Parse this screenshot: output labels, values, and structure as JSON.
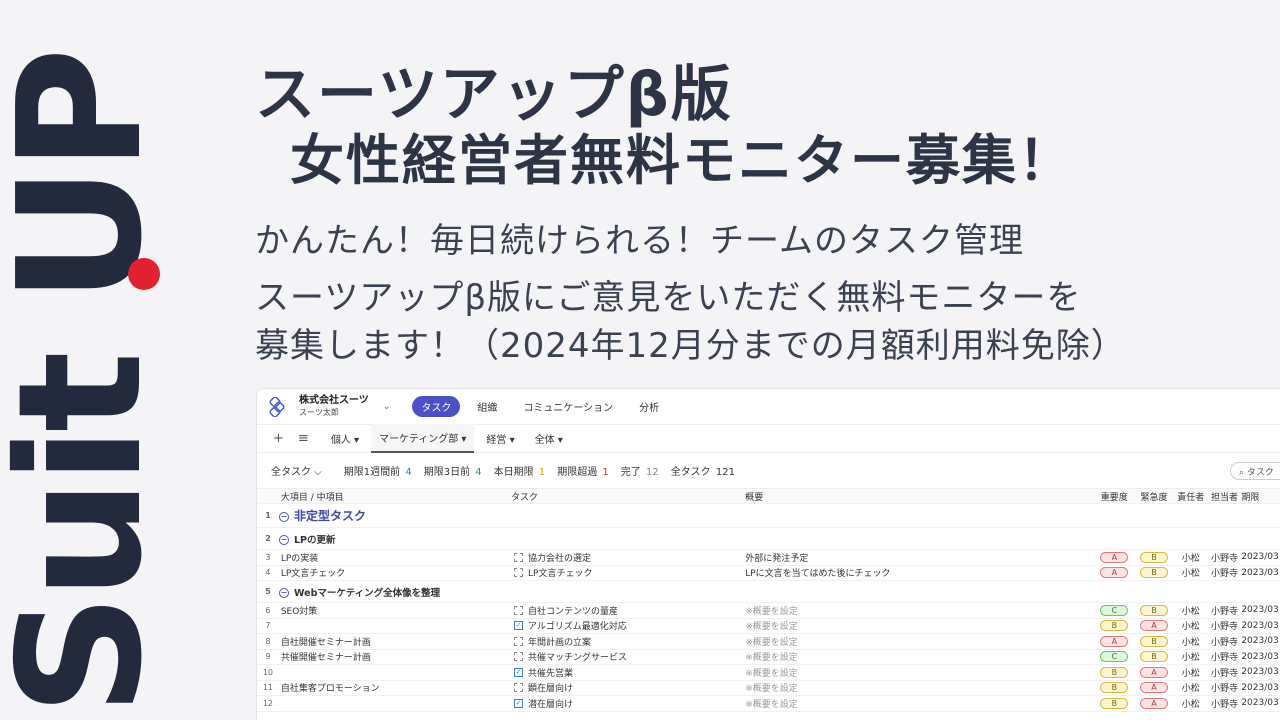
{
  "brand": {
    "logo_text": "Suit UP",
    "dot_color": "#e3212f",
    "ink_color": "#232a3d"
  },
  "headline": {
    "line1": "スーツアップβ版",
    "line2": "女性経営者無料モニター募集！"
  },
  "subtext": {
    "line1": "かんたん！毎日続けられる！チームのタスク管理",
    "line2": "スーツアップβ版にご意見をいただく無料モニターを",
    "line3": "募集します！（2024年12月分までの月額利用料免除）"
  },
  "app": {
    "company_name": "株式会社スーツ",
    "user_name": "スーツ太郎",
    "nav": [
      "タスク",
      "組織",
      "コミュニケーション",
      "分析"
    ],
    "tabs": {
      "add": "+",
      "menu": "≡",
      "items": [
        "個人 ▾",
        "マーケティング部 ▾",
        "経営 ▾",
        "全体 ▾"
      ]
    },
    "filter": {
      "all_label": "全タスク ⌵",
      "items": [
        {
          "label": "期限1週間前",
          "count": "4"
        },
        {
          "label": "期限3日前",
          "count": "4"
        },
        {
          "label": "本日期限",
          "count": "1"
        },
        {
          "label": "期限超過",
          "count": "1"
        },
        {
          "label": "完了",
          "count": "12"
        },
        {
          "label": "全タスク",
          "count": "121"
        }
      ],
      "search_placeholder": "タスク"
    },
    "columns": [
      "大項目 / 中項目",
      "タスク",
      "概要",
      "重要度",
      "緊急度",
      "責任者",
      "担当者",
      "期限"
    ],
    "groups": {
      "g1": "非定型タスク",
      "g2": "LPの更新",
      "g5": "Webマーケティング全体像を整理"
    },
    "rows": [
      {
        "num": "3",
        "cat": "LPの実装",
        "task": "協力会社の選定",
        "overview": "外部に発注予定",
        "imp": "A",
        "urg": "B",
        "owner": "小松",
        "assignee": "小野寺",
        "date": "2023/03"
      },
      {
        "num": "4",
        "cat": "LP文言チェック",
        "task": "LP文言チェック",
        "overview": "LPに文言を当てはめた後にチェック",
        "imp": "A",
        "urg": "B",
        "owner": "小松",
        "assignee": "小野寺",
        "date": "2023/03"
      },
      {
        "num": "6",
        "cat": "SEO対策",
        "task": "自社コンテンツの量産",
        "overview": "※概要を設定",
        "imp": "C",
        "urg": "B",
        "owner": "小松",
        "assignee": "小野寺",
        "date": "2023/03"
      },
      {
        "num": "7",
        "cat": "",
        "task": "アルゴリズム最適化対応",
        "overview": "※概要を設定",
        "imp": "B",
        "urg": "A",
        "owner": "小松",
        "assignee": "小野寺",
        "date": "2023/03"
      },
      {
        "num": "8",
        "cat": "自社開催セミナー計画",
        "task": "年間計画の立案",
        "overview": "※概要を設定",
        "imp": "A",
        "urg": "B",
        "owner": "小松",
        "assignee": "小野寺",
        "date": "2023/03"
      },
      {
        "num": "9",
        "cat": "共催開催セミナー計画",
        "task": "共催マッチングサービス",
        "overview": "※概要を設定",
        "imp": "C",
        "urg": "B",
        "owner": "小松",
        "assignee": "小野寺",
        "date": "2023/03"
      },
      {
        "num": "10",
        "cat": "",
        "task": "共催先営業",
        "overview": "※概要を設定",
        "imp": "B",
        "urg": "A",
        "owner": "小松",
        "assignee": "小野寺",
        "date": "2023/03"
      },
      {
        "num": "11",
        "cat": "自社集客プロモーション",
        "task": "顕在層向け",
        "overview": "※概要を設定",
        "imp": "B",
        "urg": "A",
        "owner": "小松",
        "assignee": "小野寺",
        "date": "2023/03"
      },
      {
        "num": "12",
        "cat": "",
        "task": "潜在層向け",
        "overview": "※概要を設定",
        "imp": "B",
        "urg": "A",
        "owner": "小松",
        "assignee": "小野寺",
        "date": "2023/03"
      }
    ]
  }
}
